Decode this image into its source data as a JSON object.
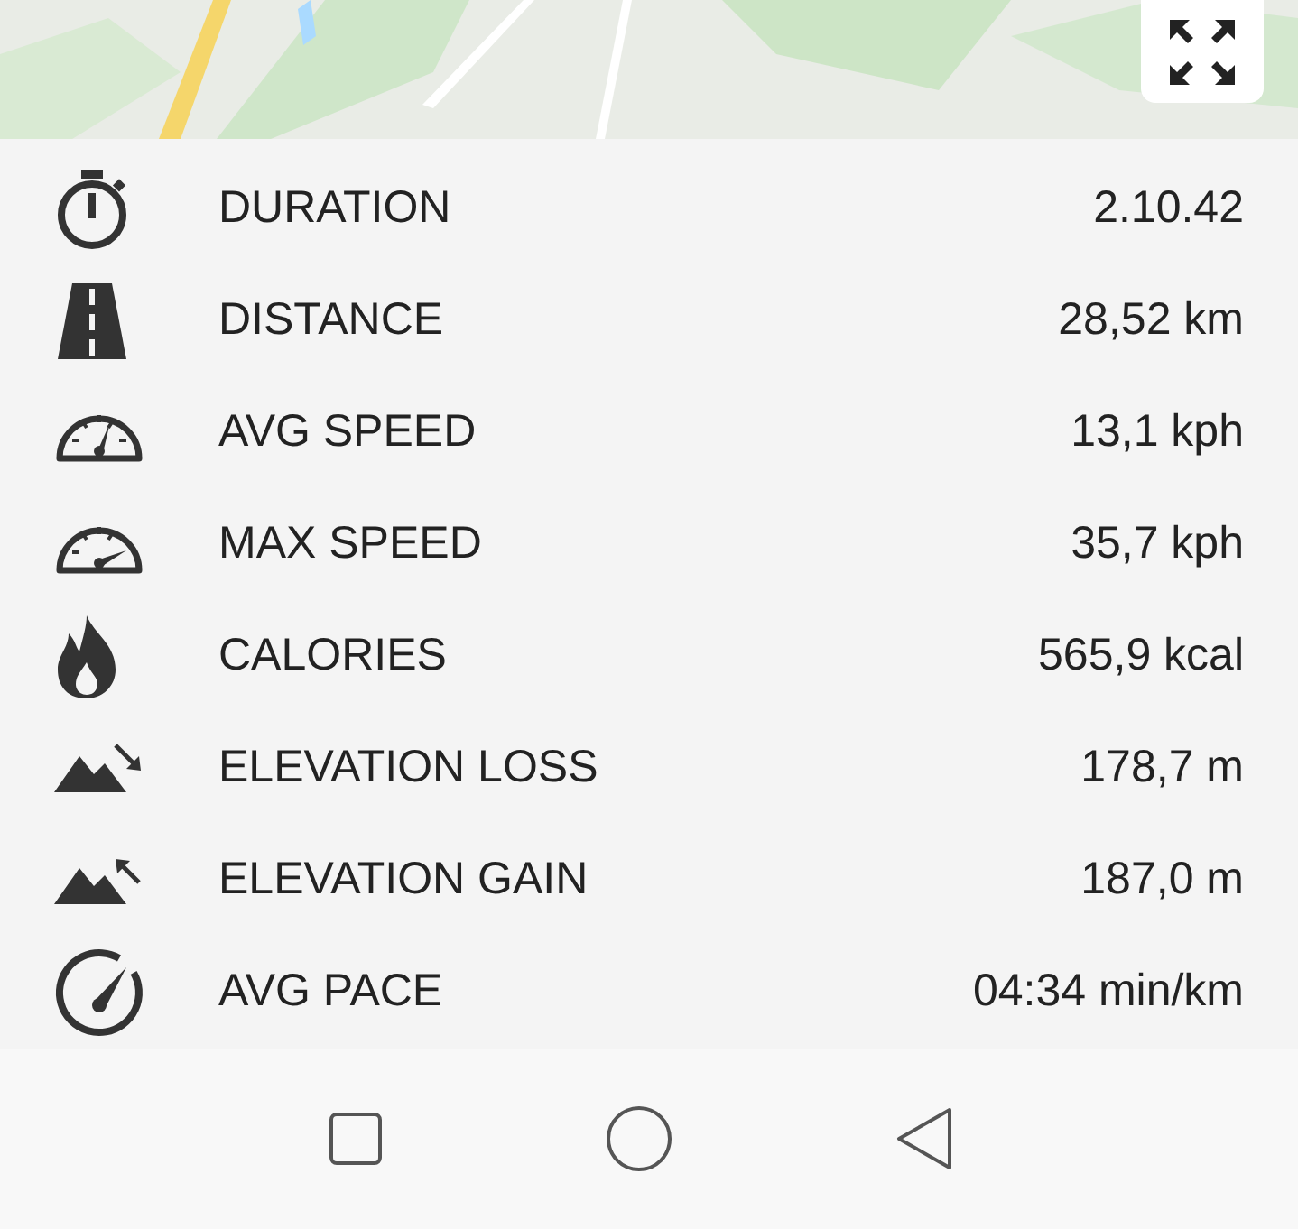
{
  "stats": [
    {
      "label": "DURATION",
      "value": "2.10.42"
    },
    {
      "label": "DISTANCE",
      "value": "28,52 km"
    },
    {
      "label": "AVG SPEED",
      "value": "13,1 kph"
    },
    {
      "label": "MAX SPEED",
      "value": "35,7 kph"
    },
    {
      "label": "CALORIES",
      "value": "565,9 kcal"
    },
    {
      "label": "ELEVATION LOSS",
      "value": "178,7 m"
    },
    {
      "label": "ELEVATION GAIN",
      "value": "187,0 m"
    },
    {
      "label": "AVG PACE",
      "value": "04:34 min/km"
    }
  ]
}
